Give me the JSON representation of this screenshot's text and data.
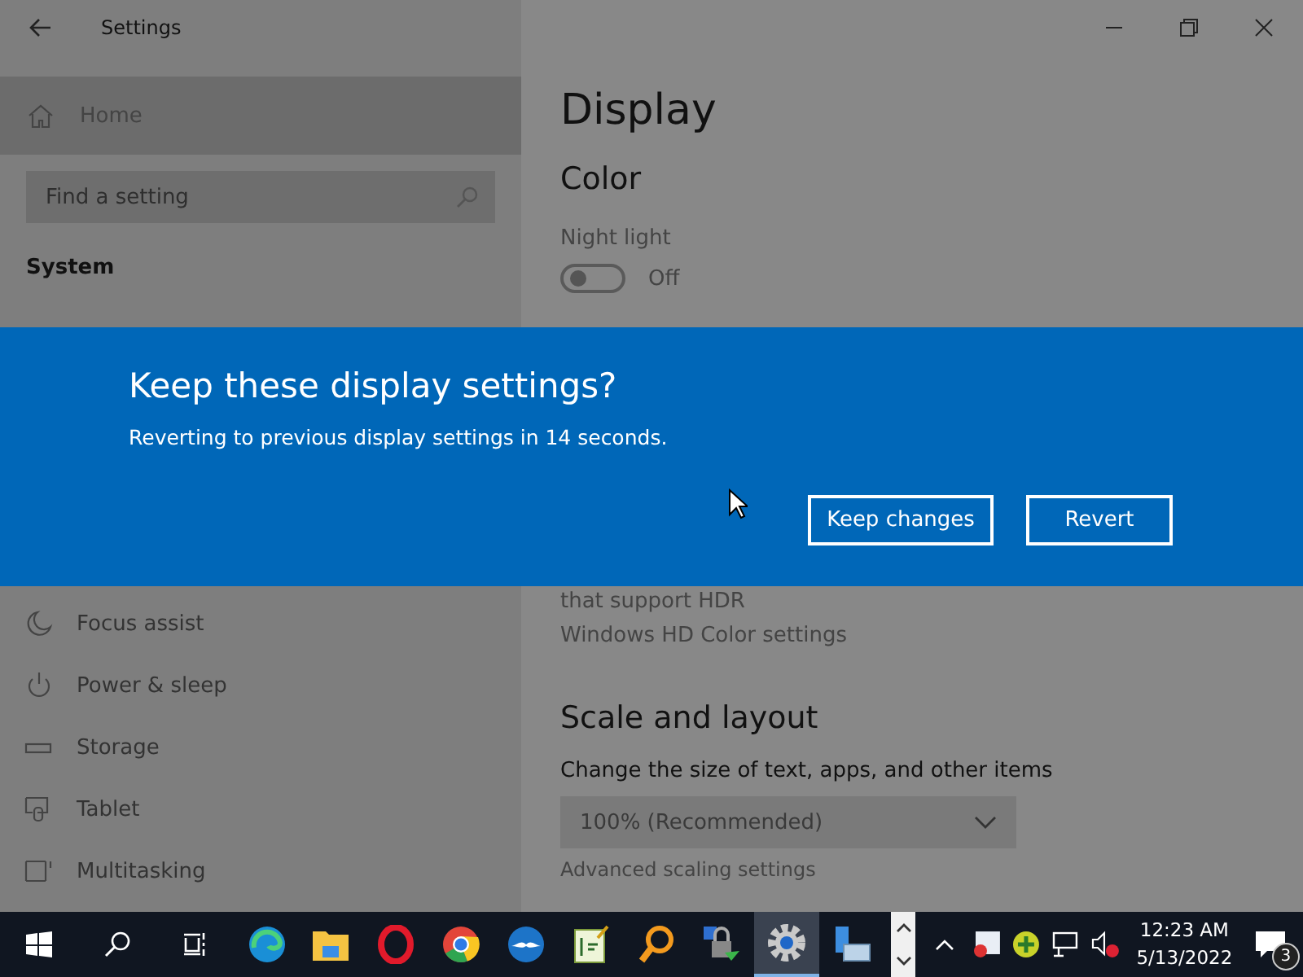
{
  "window": {
    "title": "Settings"
  },
  "sidebar": {
    "home": "Home",
    "search": {
      "placeholder": "Find a setting"
    },
    "section": "System",
    "items": [
      {
        "label": "Focus assist",
        "kind": "moon"
      },
      {
        "label": "Power & sleep",
        "kind": "power"
      },
      {
        "label": "Storage",
        "kind": "storage"
      },
      {
        "label": "Tablet",
        "kind": "tablet"
      },
      {
        "label": "Multitasking",
        "kind": "multitasking"
      }
    ]
  },
  "content": {
    "title": "Display",
    "color_heading": "Color",
    "night_light": {
      "label": "Night light",
      "on": false,
      "state": "Off"
    },
    "hdr_note": "that support HDR",
    "hdr_link": "Windows HD Color settings",
    "scale_heading": "Scale and layout",
    "scale_label": "Change the size of text, apps, and other items",
    "scale_value": "100% (Recommended)",
    "advanced_link": "Advanced scaling settings"
  },
  "dialog": {
    "title": "Keep these display settings?",
    "message": "Reverting to previous display settings in 14 seconds.",
    "buttons": [
      {
        "label": "Keep changes"
      },
      {
        "label": "Revert"
      }
    ]
  },
  "taskbar": {
    "apps": [
      {
        "kind": "edge",
        "active": false
      },
      {
        "kind": "folder",
        "active": false
      },
      {
        "kind": "opera",
        "active": false
      },
      {
        "kind": "chrome",
        "active": false
      },
      {
        "kind": "bird",
        "active": false
      },
      {
        "kind": "notepad",
        "active": false
      },
      {
        "kind": "magnifier",
        "active": false
      },
      {
        "kind": "lock",
        "active": false
      },
      {
        "kind": "gear",
        "active": true
      },
      {
        "kind": "server",
        "active": false
      }
    ],
    "tray": [
      {
        "kind": "chat"
      },
      {
        "kind": "plus"
      },
      {
        "kind": "network"
      },
      {
        "kind": "speaker"
      }
    ],
    "clock": {
      "time": "12:23 AM",
      "date": "5/13/2022"
    },
    "notifications": {
      "count": "3"
    }
  }
}
